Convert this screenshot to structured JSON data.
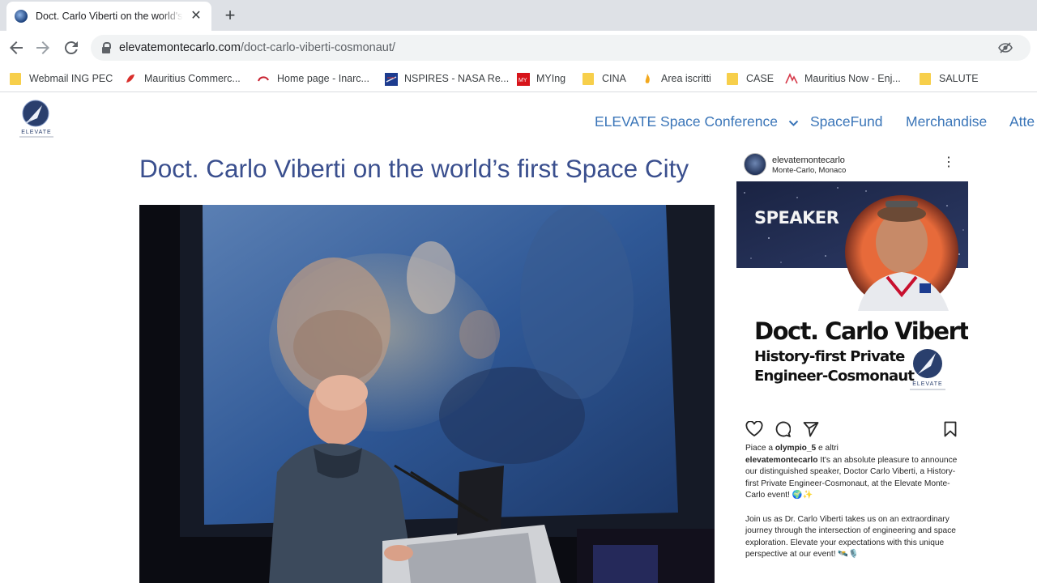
{
  "browser": {
    "tab_title": "Doct. Carlo Viberti on the world's first Space City",
    "tab_close": "✕",
    "new_tab": "+",
    "url_host": "elevatemontecarlo.com",
    "url_path": "/doct-carlo-viberti-cosmonaut/",
    "bookmarks": [
      {
        "label": "Webmail ING PEC",
        "icon": "folder-icon"
      },
      {
        "label": "Mauritius Commerc...",
        "icon": "mauritius-commerce-icon"
      },
      {
        "label": "Home page - Inarc...",
        "icon": "inarcassa-icon"
      },
      {
        "label": "NSPIRES - NASA Re...",
        "icon": "nasa-icon"
      },
      {
        "label": "MYIng",
        "icon": "mying-icon"
      },
      {
        "label": "CINA",
        "icon": "folder-icon"
      },
      {
        "label": "Area iscritti",
        "icon": "flame-icon"
      },
      {
        "label": "CASE",
        "icon": "folder-icon"
      },
      {
        "label": "Mauritius Now - Enj...",
        "icon": "mauritius-now-icon"
      },
      {
        "label": "SALUTE",
        "icon": "folder-icon"
      }
    ]
  },
  "site": {
    "nav": [
      {
        "label": "ELEVATE Space Conference"
      },
      {
        "label": "SpaceFund"
      },
      {
        "label": "Merchandise"
      },
      {
        "label": "Atte"
      }
    ],
    "logo_text": "ELEVATE"
  },
  "article": {
    "title": "Doct. Carlo Viberti on the world’s first Space City"
  },
  "instagram": {
    "username": "elevatemontecarlo",
    "location": "Monte-Carlo, Monaco",
    "card": {
      "speaker_label": "SPEAKER",
      "name": "Doct. Carlo Viberti",
      "subtitle_line1": "History-first Private",
      "subtitle_line2": "Engineer-Cosmonaut",
      "logo_text": "ELEVATE"
    },
    "likes_prefix": "Piace a ",
    "likes_user": "olympio_5",
    "likes_suffix": " e altri",
    "caption_user": "elevatemontecarlo",
    "caption_text": " It's an absolute pleasure to announce our distinguished speaker, Doctor Carlo Viberti, a History-first Private Engineer-Cosmonaut, at the Elevate Monte-Carlo event! 🌍✨",
    "caption_text2": "Join us as Dr. Carlo Viberti takes us on an extraordinary journey through the intersection of engineering and space exploration. Elevate your expectations with this unique perspective at our event! 🛰️🎙️"
  },
  "colors": {
    "nav_link": "#3a75b8",
    "title": "#3a4f8e",
    "tabstrip": "#dee1e6"
  }
}
